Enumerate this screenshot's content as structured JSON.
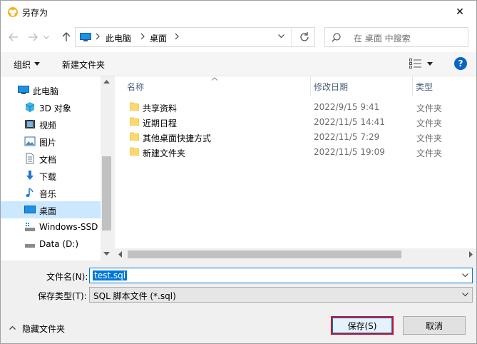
{
  "window": {
    "title": "另存为",
    "close_glyph": "✕"
  },
  "address": {
    "pc_label": "此电脑",
    "location": "桌面",
    "search_placeholder": "在 桌面 中搜索"
  },
  "toolbar": {
    "organize": "组织",
    "new_folder": "新建文件夹",
    "help": "?"
  },
  "nav_items": [
    {
      "label": "此电脑",
      "icon": "computer-icon"
    },
    {
      "label": "3D 对象",
      "icon": "cube-3d-icon"
    },
    {
      "label": "视频",
      "icon": "video-icon"
    },
    {
      "label": "图片",
      "icon": "picture-icon"
    },
    {
      "label": "文档",
      "icon": "document-icon"
    },
    {
      "label": "下载",
      "icon": "download-icon"
    },
    {
      "label": "音乐",
      "icon": "music-icon"
    },
    {
      "label": "桌面",
      "icon": "desktop-icon",
      "selected": true
    },
    {
      "label": "Windows-SSD",
      "icon": "drive-icon"
    },
    {
      "label": "Data (D:)",
      "icon": "drive-icon"
    }
  ],
  "columns": {
    "name": "名称",
    "date": "修改日期",
    "type": "类型"
  },
  "files": [
    {
      "name": "共享资料",
      "date": "2022/9/15 9:41",
      "type": "文件夹"
    },
    {
      "name": "近期日程",
      "date": "2022/11/5 14:41",
      "type": "文件夹"
    },
    {
      "name": "其他桌面快捷方式",
      "date": "2022/11/5 7:29",
      "type": "文件夹"
    },
    {
      "name": "新建文件夹",
      "date": "2022/11/5 19:09",
      "type": "文件夹"
    }
  ],
  "form": {
    "filename_label": "文件名(N):",
    "filename_value": "test.sql",
    "filetype_label": "保存类型(T):",
    "filetype_value": "SQL 脚本文件 (*.sql)"
  },
  "footer": {
    "hide_folders": "隐藏文件夹",
    "save": "保存(S)",
    "cancel": "取消"
  },
  "colors": {
    "accent": "#0078d7",
    "selection": "#cce8ff",
    "folder": "#ffd86b",
    "save_border": "#c8102e"
  }
}
